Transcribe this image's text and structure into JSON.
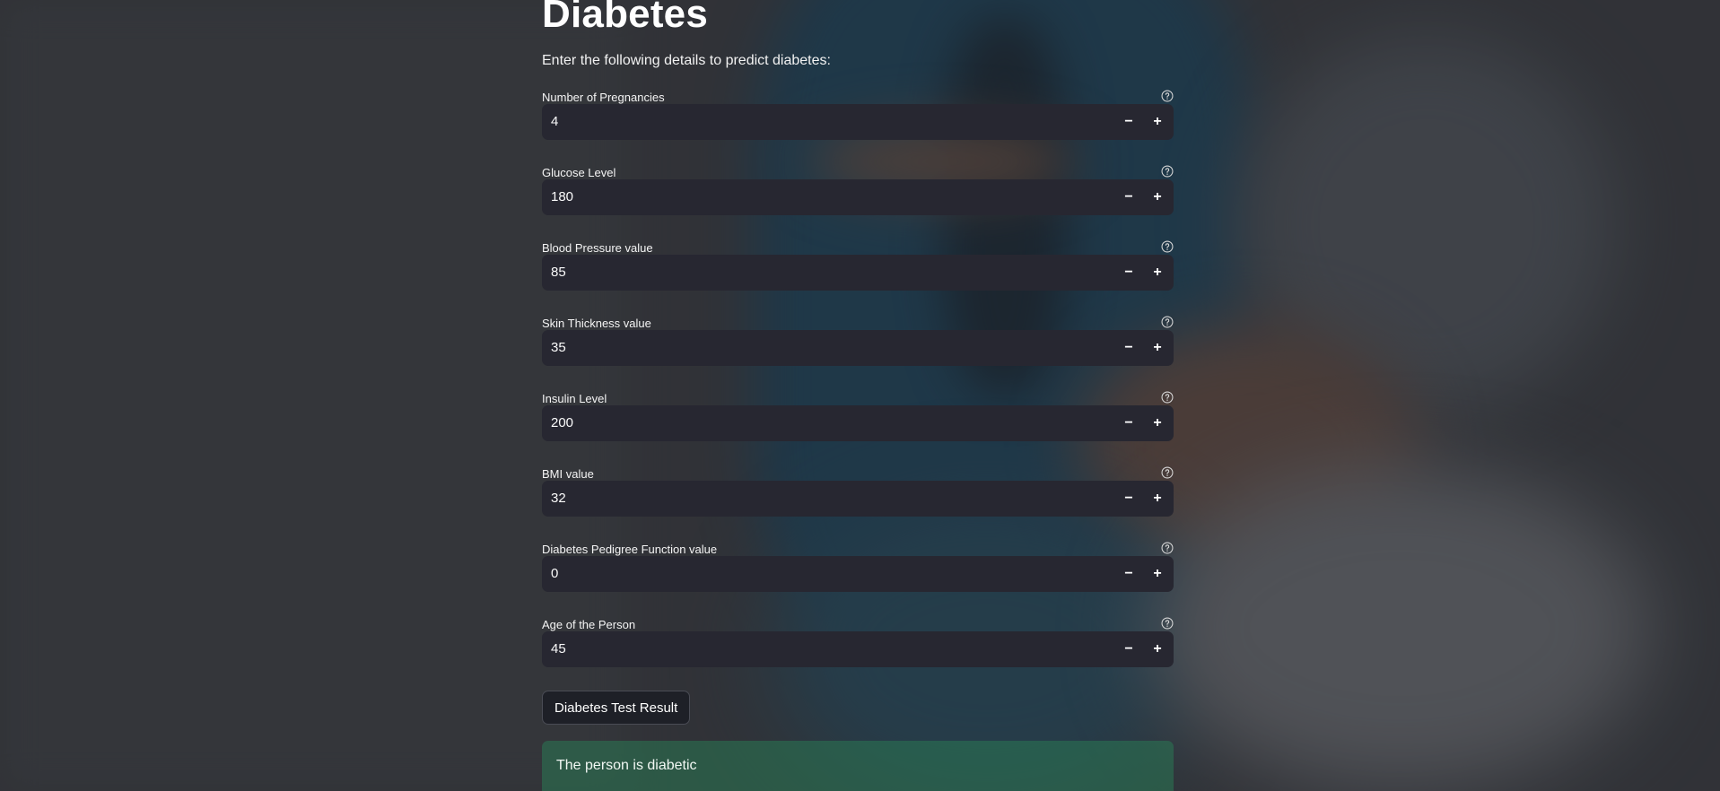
{
  "page": {
    "title": "Diabetes",
    "subtitle": "Enter the following details to predict diabetes:"
  },
  "fields": [
    {
      "label": "Number of Pregnancies",
      "value": "4"
    },
    {
      "label": "Glucose Level",
      "value": "180"
    },
    {
      "label": "Blood Pressure value",
      "value": "85"
    },
    {
      "label": "Skin Thickness value",
      "value": "35"
    },
    {
      "label": "Insulin Level",
      "value": "200"
    },
    {
      "label": "BMI value",
      "value": "32"
    },
    {
      "label": "Diabetes Pedigree Function value",
      "value": "0"
    },
    {
      "label": "Age of the Person",
      "value": "45"
    }
  ],
  "stepper": {
    "minus": "−",
    "plus": "+"
  },
  "actions": {
    "submit_label": "Diabetes Test Result"
  },
  "result": {
    "message": "The person is diabetic"
  },
  "colors": {
    "input_bg": "#272731",
    "success_bg": "#2a7854",
    "text": "#fafafa"
  }
}
